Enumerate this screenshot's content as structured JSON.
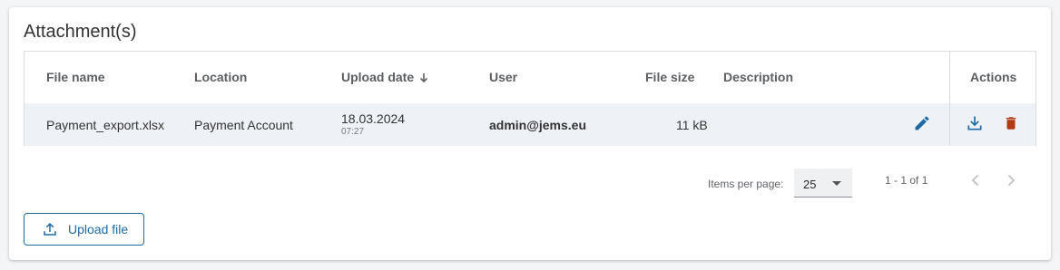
{
  "section": {
    "title": "Attachment(s)"
  },
  "table": {
    "headers": {
      "file_name": "File name",
      "location": "Location",
      "upload_date": "Upload date",
      "user": "User",
      "file_size": "File size",
      "description": "Description",
      "actions": "Actions"
    },
    "sort": {
      "column": "upload_date",
      "direction": "descending",
      "icon": "arrow-down-icon"
    },
    "rows": [
      {
        "file_name": "Payment_export.xlsx",
        "location": "Payment Account",
        "upload_date": "18.03.2024",
        "upload_time": "07:27",
        "user": "admin@jems.eu",
        "file_size": "11 kB",
        "description": "",
        "icons": [
          "pencil-icon",
          "download-icon",
          "trash-icon"
        ]
      }
    ]
  },
  "paginator": {
    "items_per_page_label": "Items per page:",
    "items_per_page_value": "25",
    "range_label": "1 - 1 of 1"
  },
  "upload_button": {
    "label": "Upload file",
    "icon": "upload-icon"
  },
  "colors": {
    "accent": "#1f6aa5",
    "danger": "#b23a14",
    "row_bg": "#eef2f6",
    "border": "#d9dde1"
  }
}
